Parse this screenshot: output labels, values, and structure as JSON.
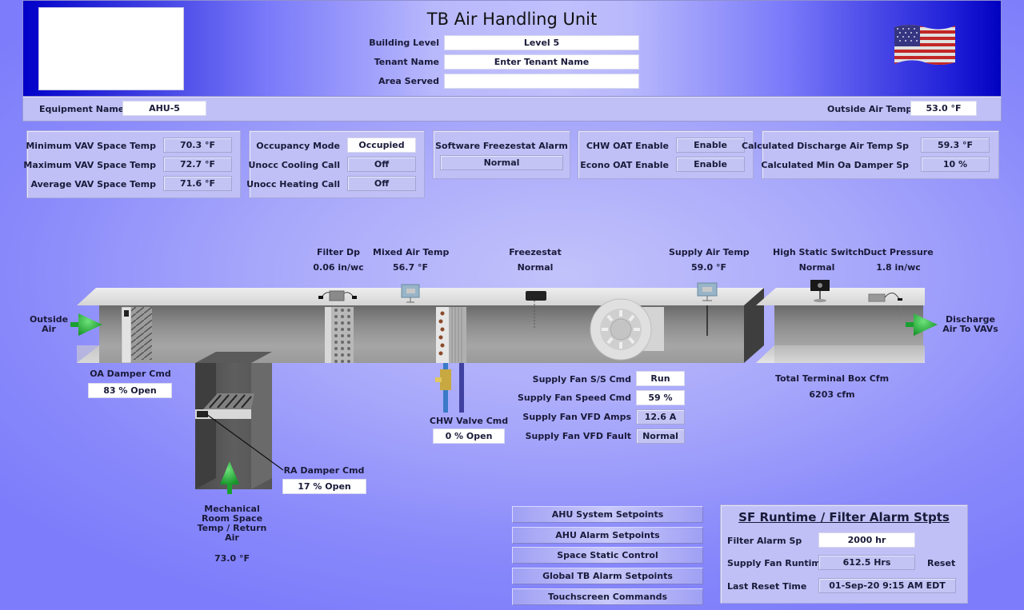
{
  "header": {
    "title": "TB Air Handling Unit",
    "building_level_label": "Building Level",
    "building_level_value": "Level 5",
    "tenant_name_label": "Tenant Name",
    "tenant_name_value": "Enter Tenant Name",
    "area_served_label": "Area Served",
    "area_served_value": "",
    "flag_icon": "us-flag-icon",
    "logo": "logo-placeholder"
  },
  "subheader": {
    "equipment_name_label": "Equipment Name",
    "equipment_name_value": "AHU-5",
    "outside_air_temp_label": "Outside Air Temp",
    "outside_air_temp_value": "53.0 °F"
  },
  "vav_panel": {
    "rows": [
      {
        "label": "Minimum VAV Space Temp",
        "value": "70.3 °F"
      },
      {
        "label": "Maximum VAV Space Temp",
        "value": "72.7 °F"
      },
      {
        "label": "Average VAV Space Temp",
        "value": "71.6 °F"
      }
    ]
  },
  "occupancy_panel": {
    "rows": [
      {
        "label": "Occupancy Mode",
        "value": "Occupied"
      },
      {
        "label": "Unocc Cooling Call",
        "value": "Off"
      },
      {
        "label": "Unocc Heating Call",
        "value": "Off"
      }
    ]
  },
  "freezestat_panel": {
    "label": "Software Freezestat Alarm",
    "value": "Normal"
  },
  "oat_panel": {
    "rows": [
      {
        "label": "CHW OAT Enable",
        "value": "Enable"
      },
      {
        "label": "Econo OAT Enable",
        "value": "Enable"
      }
    ]
  },
  "calc_panel": {
    "rows": [
      {
        "label": "Calculated Discharge Air Temp Sp",
        "value": "59.3 °F"
      },
      {
        "label": "Calculated Min Oa Damper Sp",
        "value": "10 %"
      }
    ]
  },
  "diagram": {
    "outside_air_label": "Outside\nAir",
    "outside_air_line1": "Outside",
    "outside_air_line2": "Air",
    "discharge_line1": "Discharge",
    "discharge_line2": "Air To VAVs",
    "filter_dp_label": "Filter Dp",
    "filter_dp_value": "0.06 in/wc",
    "mixed_air_temp_label": "Mixed Air Temp",
    "mixed_air_temp_value": "56.7 °F",
    "freezestat_label": "Freezestat",
    "freezestat_value": "Normal",
    "supply_air_temp_label": "Supply Air Temp",
    "supply_air_temp_value": "59.0 °F",
    "high_static_label": "High Static Switch",
    "high_static_value": "Normal",
    "duct_pressure_label": "Duct Pressure",
    "duct_pressure_value": "1.8 in/wc",
    "oa_damper_label": "OA Damper Cmd",
    "oa_damper_value": "83 % Open",
    "ra_damper_label": "RA Damper Cmd",
    "ra_damper_value": "17 % Open",
    "chw_valve_label": "CHW Valve Cmd",
    "chw_valve_value": "0 % Open",
    "return_air_line1": "Mechanical",
    "return_air_line2": "Room Space",
    "return_air_line3": "Temp / Return",
    "return_air_line4": "Air",
    "return_air_value": "73.0 °F",
    "total_cfm_label": "Total Terminal Box Cfm",
    "total_cfm_value": "6203 cfm",
    "arrow_color": "#22b33a"
  },
  "supply_fan": {
    "rows": [
      {
        "label": "Supply Fan S/S Cmd",
        "value": "Run"
      },
      {
        "label": "Supply Fan Speed Cmd",
        "value": "59 %"
      },
      {
        "label": "Supply Fan VFD Amps",
        "value": "12.6 A"
      },
      {
        "label": "Supply Fan VFD Fault",
        "value": "Normal"
      }
    ]
  },
  "nav_buttons": [
    {
      "label": "AHU System Setpoints"
    },
    {
      "label": "AHU Alarm Setpoints"
    },
    {
      "label": "Space Static Control"
    },
    {
      "label": "Global TB Alarm Setpoints"
    },
    {
      "label": "Touchscreen Commands"
    }
  ],
  "sf_runtime": {
    "title": "SF Runtime / Filter Alarm Stpts",
    "filter_alarm_sp_label": "Filter Alarm Sp",
    "filter_alarm_sp_value": "2000 hr",
    "runtime_label": "Supply Fan Runtime",
    "runtime_value": "612.5 Hrs",
    "reset_label": "Reset",
    "last_reset_label": "Last Reset Time",
    "last_reset_value": "01-Sep-20 9:15 AM EDT"
  }
}
